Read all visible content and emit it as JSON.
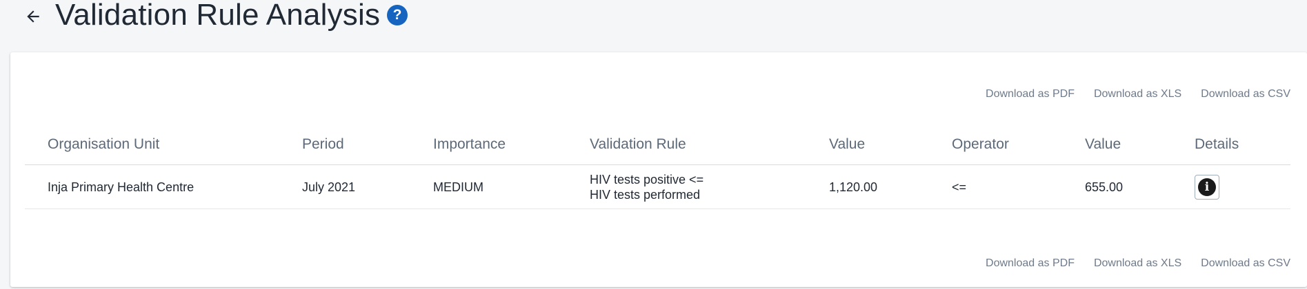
{
  "header": {
    "title": "Validation Rule Analysis",
    "back_icon": "arrow-left-icon",
    "help_icon": "help-circle-icon",
    "help_glyph": "?",
    "help_color": "#1565c0"
  },
  "downloads": {
    "pdf": "Download as PDF",
    "xls": "Download as XLS",
    "csv": "Download as CSV"
  },
  "table": {
    "headers": [
      "Organisation Unit",
      "Period",
      "Importance",
      "Validation Rule",
      "Value",
      "Operator",
      "Value",
      "Details"
    ],
    "rows": [
      {
        "org_unit": "Inja Primary Health Centre",
        "period": "July 2021",
        "importance": "MEDIUM",
        "rule_line1": "HIV tests positive <=",
        "rule_line2": "HIV tests performed",
        "left_value": "1,120.00",
        "operator": "<=",
        "right_value": "655.00",
        "details_icon": "info-icon",
        "details_glyph": "i"
      }
    ]
  }
}
